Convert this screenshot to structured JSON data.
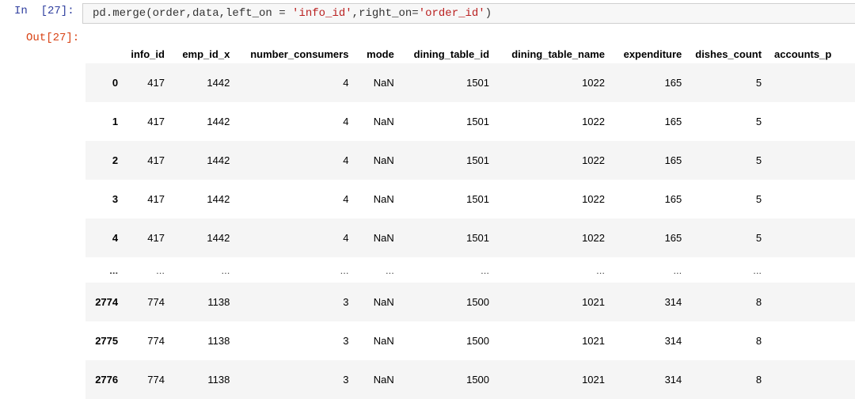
{
  "cell": {
    "in_prompt": "In  [27]:",
    "out_prompt": "Out[27]:",
    "code": {
      "fn": "pd.merge(order,data,left_on = ",
      "s1": "'info_id'",
      "mid": ",right_on=",
      "s2": "'order_id'",
      "end": ")"
    }
  },
  "table": {
    "columns": [
      "",
      "info_id",
      "emp_id_x",
      "number_consumers",
      "mode",
      "dining_table_id",
      "dining_table_name",
      "expenditure",
      "dishes_count",
      "accounts_p"
    ],
    "rows": [
      {
        "index": "0",
        "cells": [
          "417",
          "1442",
          "4",
          "NaN",
          "1501",
          "1022",
          "165",
          "5",
          ""
        ]
      },
      {
        "index": "1",
        "cells": [
          "417",
          "1442",
          "4",
          "NaN",
          "1501",
          "1022",
          "165",
          "5",
          ""
        ]
      },
      {
        "index": "2",
        "cells": [
          "417",
          "1442",
          "4",
          "NaN",
          "1501",
          "1022",
          "165",
          "5",
          ""
        ]
      },
      {
        "index": "3",
        "cells": [
          "417",
          "1442",
          "4",
          "NaN",
          "1501",
          "1022",
          "165",
          "5",
          ""
        ]
      },
      {
        "index": "4",
        "cells": [
          "417",
          "1442",
          "4",
          "NaN",
          "1501",
          "1022",
          "165",
          "5",
          ""
        ]
      },
      {
        "index": "...",
        "cells": [
          "...",
          "...",
          "...",
          "...",
          "...",
          "...",
          "...",
          "...",
          ""
        ]
      },
      {
        "index": "2774",
        "cells": [
          "774",
          "1138",
          "3",
          "NaN",
          "1500",
          "1021",
          "314",
          "8",
          ""
        ]
      },
      {
        "index": "2775",
        "cells": [
          "774",
          "1138",
          "3",
          "NaN",
          "1500",
          "1021",
          "314",
          "8",
          ""
        ]
      },
      {
        "index": "2776",
        "cells": [
          "774",
          "1138",
          "3",
          "NaN",
          "1500",
          "1021",
          "314",
          "8",
          ""
        ]
      }
    ]
  }
}
